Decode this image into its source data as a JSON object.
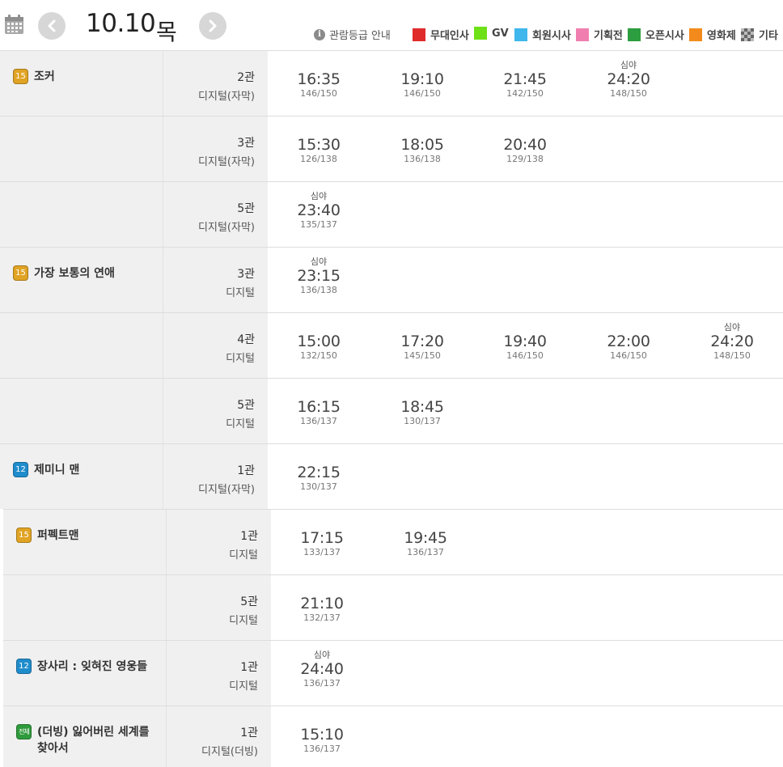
{
  "header": {
    "date": "10.10",
    "weekday": "목",
    "rating_guide": "관람등급 안내",
    "legend": [
      {
        "label": "무대인사",
        "color": "#e02b2b"
      },
      {
        "label": "GV",
        "color": "#6ee017"
      },
      {
        "label": "회원시사",
        "color": "#3fb6ec"
      },
      {
        "label": "기획전",
        "color": "#f07fb0"
      },
      {
        "label": "오픈시사",
        "color": "#2d9e3f"
      },
      {
        "label": "영화제",
        "color": "#f28b1c"
      },
      {
        "label": "기타",
        "color": "checker"
      }
    ]
  },
  "colors": {
    "rating_15": "#e0a324",
    "rating_12": "#1f8ccc",
    "rating_all": "#2f9a3c"
  },
  "late_label": "심야",
  "rows": [
    {
      "rating": "15",
      "title": "조커",
      "hall": "2관",
      "type": "디지털(자막)",
      "times": [
        {
          "time": "16:35",
          "seats": "146/150",
          "late": false
        },
        {
          "time": "19:10",
          "seats": "146/150",
          "late": false
        },
        {
          "time": "21:45",
          "seats": "142/150",
          "late": false
        },
        {
          "time": "24:20",
          "seats": "148/150",
          "late": true
        }
      ]
    },
    {
      "rating": "",
      "title": "",
      "hall": "3관",
      "type": "디지털(자막)",
      "times": [
        {
          "time": "15:30",
          "seats": "126/138",
          "late": false
        },
        {
          "time": "18:05",
          "seats": "136/138",
          "late": false
        },
        {
          "time": "20:40",
          "seats": "129/138",
          "late": false
        }
      ]
    },
    {
      "rating": "",
      "title": "",
      "hall": "5관",
      "type": "디지털(자막)",
      "times": [
        {
          "time": "23:40",
          "seats": "135/137",
          "late": true
        }
      ]
    },
    {
      "rating": "15",
      "title": "가장 보통의 연애",
      "hall": "3관",
      "type": "디지털",
      "times": [
        {
          "time": "23:15",
          "seats": "136/138",
          "late": true
        }
      ]
    },
    {
      "rating": "",
      "title": "",
      "hall": "4관",
      "type": "디지털",
      "times": [
        {
          "time": "15:00",
          "seats": "132/150",
          "late": false
        },
        {
          "time": "17:20",
          "seats": "145/150",
          "late": false
        },
        {
          "time": "19:40",
          "seats": "146/150",
          "late": false
        },
        {
          "time": "22:00",
          "seats": "146/150",
          "late": false
        },
        {
          "time": "24:20",
          "seats": "148/150",
          "late": true
        }
      ]
    },
    {
      "rating": "",
      "title": "",
      "hall": "5관",
      "type": "디지털",
      "times": [
        {
          "time": "16:15",
          "seats": "136/137",
          "late": false
        },
        {
          "time": "18:45",
          "seats": "130/137",
          "late": false
        }
      ]
    },
    {
      "rating": "12",
      "title": "제미니 맨",
      "hall": "1관",
      "type": "디지털(자막)",
      "times": [
        {
          "time": "22:15",
          "seats": "130/137",
          "late": false
        }
      ]
    },
    {
      "rating": "15",
      "title": "퍼펙트맨",
      "hall": "1관",
      "type": "디지털",
      "times": [
        {
          "time": "17:15",
          "seats": "133/137",
          "late": false
        },
        {
          "time": "19:45",
          "seats": "136/137",
          "late": false
        }
      ]
    },
    {
      "rating": "",
      "title": "",
      "hall": "5관",
      "type": "디지털",
      "times": [
        {
          "time": "21:10",
          "seats": "132/137",
          "late": false
        }
      ]
    },
    {
      "rating": "12",
      "title": "장사리 : 잊혀진 영웅들",
      "hall": "1관",
      "type": "디지털",
      "times": [
        {
          "time": "24:40",
          "seats": "136/137",
          "late": true
        }
      ]
    },
    {
      "rating": "all",
      "rating_label": "전체",
      "title": "(더빙) 잃어버린 세계를 찾아서",
      "hall": "1관",
      "type": "디지털(더빙)",
      "times": [
        {
          "time": "15:10",
          "seats": "136/137",
          "late": false
        }
      ]
    }
  ]
}
